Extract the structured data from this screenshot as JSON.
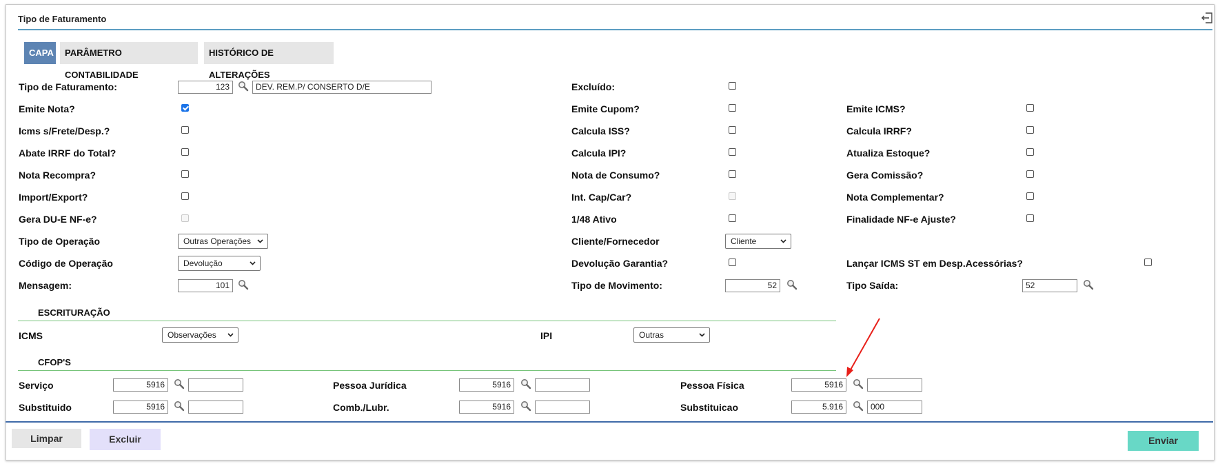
{
  "window": {
    "title": "Tipo de Faturamento"
  },
  "tabs": [
    {
      "label": "CAPA",
      "active": true
    },
    {
      "label": "PARÂMETRO CONTABILIDADE",
      "active": false
    },
    {
      "label": "HISTÓRICO DE ALTERAÇÕES",
      "active": false
    }
  ],
  "col1": {
    "tipo_faturamento": {
      "label": "Tipo de Faturamento:",
      "code": "123",
      "description": "DEV. REM.P/ CONSERTO D/E"
    },
    "emite_nota": {
      "label": "Emite Nota?",
      "checked": true
    },
    "icms_frete": {
      "label": "Icms s/Frete/Desp.?",
      "checked": false
    },
    "abate_irrf": {
      "label": "Abate IRRF do Total?",
      "checked": false
    },
    "nota_recompra": {
      "label": "Nota Recompra?",
      "checked": false
    },
    "import_export": {
      "label": "Import/Export?",
      "checked": false
    },
    "gera_due": {
      "label": "Gera DU-E NF-e?",
      "checked": false,
      "disabled": true
    },
    "tipo_operacao": {
      "label": "Tipo de Operação",
      "value": "Outras Operações"
    },
    "codigo_operacao": {
      "label": "Código de Operação",
      "value": "Devolução"
    },
    "mensagem": {
      "label": "Mensagem:",
      "value": "101"
    }
  },
  "col2": {
    "excluido": {
      "label": "Excluído:",
      "checked": false
    },
    "emite_cupom": {
      "label": "Emite Cupom?",
      "checked": false
    },
    "calcula_iss": {
      "label": "Calcula ISS?",
      "checked": false
    },
    "calcula_ipi": {
      "label": "Calcula IPI?",
      "checked": false
    },
    "nota_consumo": {
      "label": "Nota de Consumo?",
      "checked": false
    },
    "int_cap_car": {
      "label": "Int. Cap/Car?",
      "checked": false,
      "disabled": true
    },
    "ativo_148": {
      "label": "1/48 Ativo",
      "checked": false
    },
    "cliente_fornecedor": {
      "label": "Cliente/Fornecedor",
      "value": "Cliente"
    },
    "devolucao_garantia": {
      "label": "Devolução Garantia?",
      "checked": false
    },
    "tipo_movimento": {
      "label": "Tipo de Movimento:",
      "value": "52"
    }
  },
  "col3": {
    "emite_icms": {
      "label": "Emite ICMS?",
      "checked": false
    },
    "calcula_irrf": {
      "label": "Calcula IRRF?",
      "checked": false
    },
    "atualiza_estoque": {
      "label": "Atualiza Estoque?",
      "checked": false
    },
    "gera_comissao": {
      "label": "Gera Comissão?",
      "checked": false
    },
    "nota_complementar": {
      "label": "Nota Complementar?",
      "checked": false
    },
    "finalidade_ajuste": {
      "label": "Finalidade NF-e Ajuste?",
      "checked": false
    },
    "lancar_icms_st": {
      "label": "Lançar ICMS ST em Desp.Acessórias?",
      "checked": false
    },
    "tipo_saida": {
      "label": "Tipo Saída:",
      "value": "52"
    }
  },
  "escrituracao": {
    "heading": "ESCRITURAÇÃO",
    "icms": {
      "label": "ICMS",
      "value": "Observações"
    },
    "ipi": {
      "label": "IPI",
      "value": "Outras"
    }
  },
  "cfops": {
    "heading": "CFOP'S",
    "servico": {
      "label": "Serviço",
      "code": "5916",
      "extra": ""
    },
    "substituido": {
      "label": "Substituido",
      "code": "5916",
      "extra": ""
    },
    "pessoa_juridica": {
      "label": "Pessoa Jurídica",
      "code": "5916",
      "extra": ""
    },
    "comb_lubr": {
      "label": "Comb./Lubr.",
      "code": "5916",
      "extra": ""
    },
    "pessoa_fisica": {
      "label": "Pessoa Física",
      "code": "5916",
      "extra": ""
    },
    "substituicao": {
      "label": "Substituicao",
      "code": "5.916",
      "extra": "000"
    }
  },
  "footer": {
    "limpar": "Limpar",
    "excluir": "Excluir",
    "enviar": "Enviar"
  },
  "colors": {
    "tab_active": "#5d84b3",
    "title_line": "#5c9dc2",
    "section_line": "#77c47a",
    "enviar_bg": "#68d8c6",
    "excluir_bg": "#e3e0fa",
    "limpar_bg": "#e6e6e6",
    "annotation_arrow": "#e8201a"
  },
  "icons": [
    "exit-icon",
    "search-icon",
    "chevron-down-icon",
    "annotation-arrow"
  ]
}
